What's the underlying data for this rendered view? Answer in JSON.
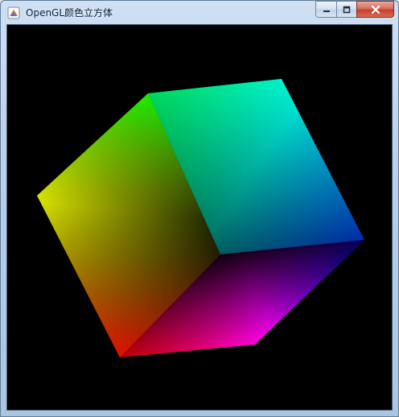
{
  "window": {
    "title": "OpenGL颜色立方体",
    "app_icon": "opengl-app-icon",
    "controls": [
      {
        "name": "minimize-button",
        "icon": "minimize-icon"
      },
      {
        "name": "maximize-button",
        "icon": "maximize-icon"
      },
      {
        "name": "close-button",
        "icon": "close-icon"
      }
    ]
  },
  "canvas": {
    "background": "#000000",
    "scene": "rgb-color-cube",
    "vertex_colors": {
      "yellow": "#ffff00",
      "green": "#00ff00",
      "cyan": "#00ffff",
      "blue": "#0000ff",
      "magenta": "#ff00ff",
      "red": "#ff0000",
      "black": "#000000"
    }
  }
}
